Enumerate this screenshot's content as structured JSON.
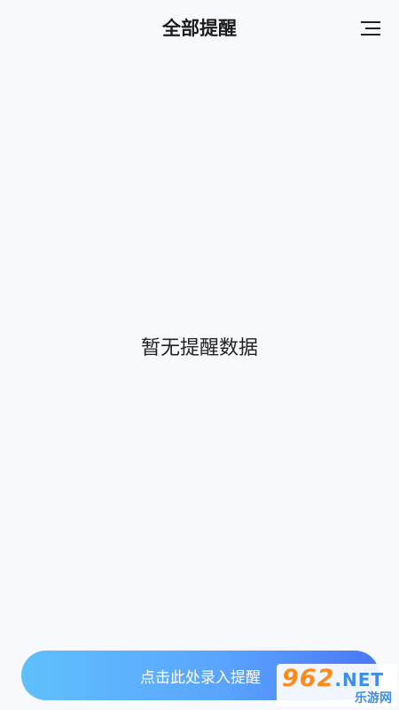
{
  "header": {
    "title": "全部提醒",
    "menu_icon": "menu-icon"
  },
  "main": {
    "empty_message": "暂无提醒数据"
  },
  "footer": {
    "add_button_label": "点击此处录入提醒"
  },
  "watermark": {
    "number": "962",
    "suffix": ".NET",
    "subtitle": "乐游网"
  },
  "colors": {
    "background": "#f7f9fc",
    "button_gradient_start": "#5fc0fb",
    "button_gradient_end": "#4a78f5",
    "watermark_orange": "#ff8a1a",
    "watermark_blue": "#3d8ee8"
  }
}
